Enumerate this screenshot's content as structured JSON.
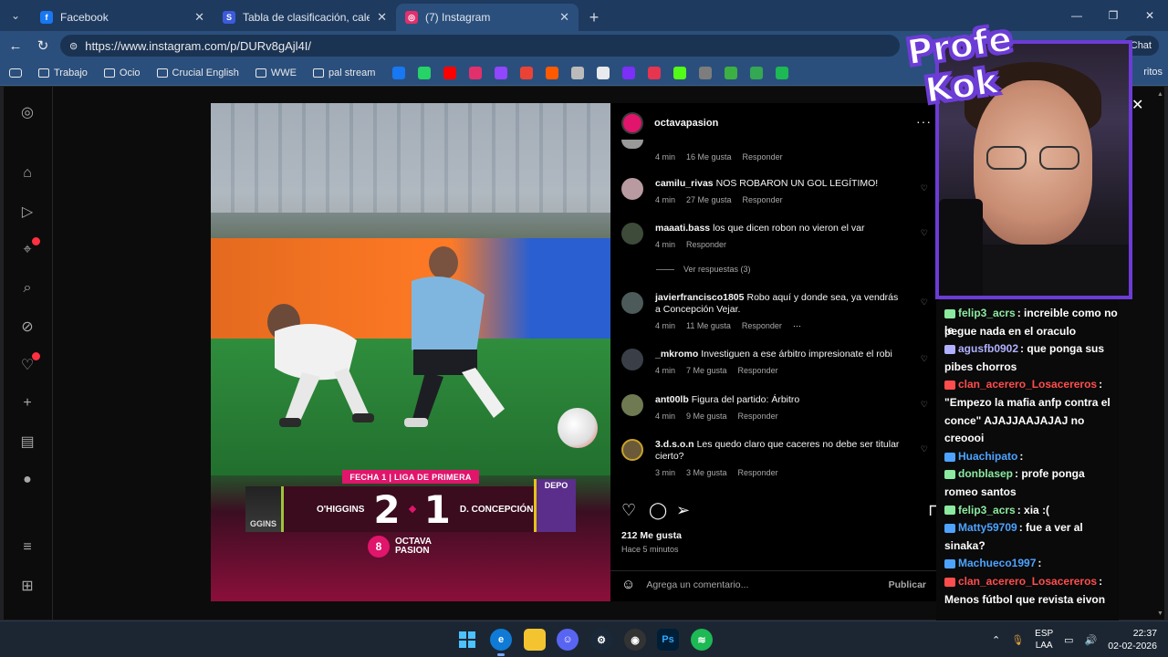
{
  "browser": {
    "tabs": [
      {
        "label": "Facebook",
        "color": "#1877f2",
        "glyph": "f",
        "active": false
      },
      {
        "label": "Tabla de clasificación, calendario y",
        "color": "#3b5bdb",
        "glyph": "S",
        "active": false
      },
      {
        "label": "(7) Instagram",
        "color": "#e1306c",
        "glyph": "◎",
        "active": true
      }
    ],
    "url": "https://www.instagram.com/p/DURv8gAjl4I/",
    "chat_label": "Chat",
    "bookmarks": [
      {
        "label": "Trabajo"
      },
      {
        "label": "Ocio"
      },
      {
        "label": "Crucial English"
      },
      {
        "label": "WWE"
      },
      {
        "label": "pal stream"
      }
    ],
    "bookmark_icons": [
      "#1877f2",
      "#25d366",
      "#ff0000",
      "#e1306c",
      "#9146ff",
      "#ea4335",
      "#ff5a00",
      "#bbbbbb",
      "#e8eaed",
      "#7b2ff7",
      "#e7344f",
      "#53fc18",
      "#7d7d7d",
      "#3cb043",
      "#34a853",
      "#1db954"
    ],
    "favorites_tail": "ritos"
  },
  "post": {
    "username": "octavapasion",
    "scoreboard": {
      "label": "FECHA 1 | LIGA DE PRIMERA",
      "home": "O'HIGGINS",
      "home_score": "2",
      "away_score": "1",
      "away": "D. CONCEPCIÓN",
      "crest_left": "GGINS",
      "crest_right": "DEPO",
      "brand_line1": "OCTAVA",
      "brand_line2": "PASION"
    },
    "comments": [
      {
        "user": "",
        "text": "",
        "time": "4 min",
        "likes": "16 Me gusta",
        "reply": "Responder"
      },
      {
        "user": "camilu_rivas",
        "text": "NOS ROBARON UN GOL LEGÍTIMO!",
        "time": "4 min",
        "likes": "27 Me gusta",
        "reply": "Responder"
      },
      {
        "user": "maaati.bass",
        "text": "los que dicen robon no vieron el var",
        "time": "4 min",
        "likes": "",
        "reply": "Responder"
      },
      {
        "user": "javierfrancisco1805",
        "text": "Robo aquí y donde sea, ya vendrás a Concepción Vejar.",
        "time": "4 min",
        "likes": "11 Me gusta",
        "reply": "Responder"
      },
      {
        "user": "_mkromo",
        "text": "Investiguen a ese árbitro impresionate el robi",
        "time": "4 min",
        "likes": "7 Me gusta",
        "reply": "Responder"
      },
      {
        "user": "ant00lb",
        "text": "Figura del partido: Árbitro",
        "time": "4 min",
        "likes": "9 Me gusta",
        "reply": "Responder"
      },
      {
        "user": "3.d.s.o.n",
        "text": "Les quedo claro que caceres no debe ser titular cierto?",
        "time": "3 min",
        "likes": "3 Me gusta",
        "reply": "Responder"
      }
    ],
    "view_replies": "Ver respuestas (3)",
    "likes_total": "212 Me gusta",
    "posted_ago": "Hace 5 minutos",
    "add_comment_placeholder": "Agrega un comentario...",
    "publish_label": "Publicar",
    "more_dots": "···"
  },
  "stream": {
    "logo_line1": "Profe",
    "logo_line2": "Kok",
    "chat": [
      {
        "name": "felip3_acrs",
        "msg": ": increible como no le",
        "color": "#8be9a0"
      },
      {
        "name": "",
        "msg": "pegue nada en el oraculo",
        "color": "#ffffff"
      },
      {
        "name": "agusfb0902",
        "msg": ": que ponga sus",
        "color": "#b0b0ff"
      },
      {
        "name": "",
        "msg": "pibes chorros",
        "color": "#ffffff"
      },
      {
        "name": "clan_acerero_Losacereros",
        "msg": ":",
        "color": "#ff4d4d"
      },
      {
        "name": "",
        "msg": "\"Empezo la mafia anfp contra el",
        "color": "#ffffff"
      },
      {
        "name": "",
        "msg": "conce\" AJAJJAAJAJAJ no",
        "color": "#ffffff"
      },
      {
        "name": "",
        "msg": "creoooi",
        "color": "#ffffff"
      },
      {
        "name": "Huachipato",
        "msg": ":",
        "color": "#4da3ff"
      },
      {
        "name": "donblasep",
        "msg": ": profe ponga",
        "color": "#8be9a0"
      },
      {
        "name": "",
        "msg": "romeo santos",
        "color": "#ffffff"
      },
      {
        "name": "felip3_acrs",
        "msg": ": xia :(",
        "color": "#8be9a0"
      },
      {
        "name": "Matty59709",
        "msg": ": fue a ver al",
        "color": "#4da3ff"
      },
      {
        "name": "",
        "msg": "sinaka?",
        "color": "#ffffff"
      },
      {
        "name": "Machueco1997",
        "msg": ":",
        "color": "#4da3ff"
      },
      {
        "name": "clan_acerero_Losacereros",
        "msg": ":",
        "color": "#ff4d4d"
      },
      {
        "name": "",
        "msg": "Menos fútbol que revista eivon",
        "color": "#ffffff"
      }
    ]
  },
  "taskbar": {
    "lang1": "ESP",
    "lang2": "LAA",
    "time": "22:37",
    "date": "02-02-2026"
  }
}
